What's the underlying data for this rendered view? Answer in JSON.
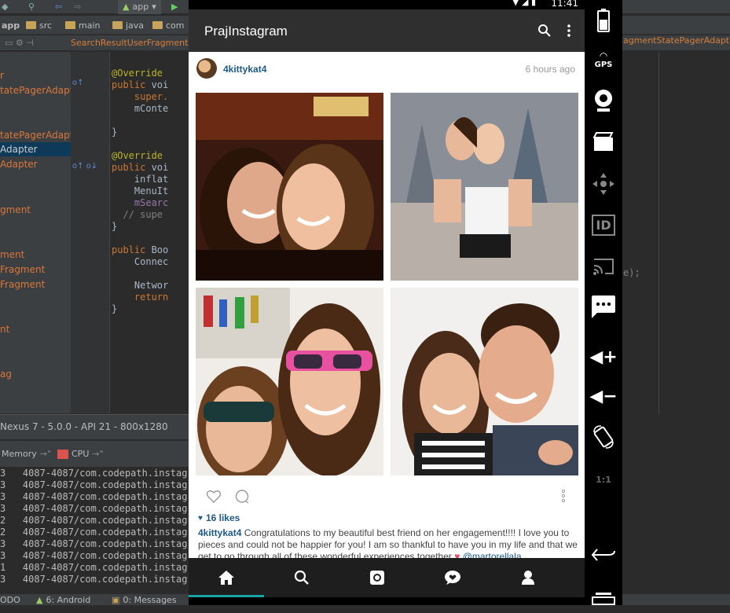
{
  "ide": {
    "toolbar": {
      "run_config": "app"
    },
    "breadcrumb": [
      "app",
      "src",
      "main",
      "java",
      "com"
    ],
    "open_tab": "SearchResultUserFragment.j",
    "right_tab": "agmentStatePagerAdapter",
    "project_items": [
      {
        "label": "r",
        "selected": false
      },
      {
        "label": "tatePagerAdapter",
        "selected": false
      },
      {
        "label": "tatePagerAdapter",
        "selected": false
      },
      {
        "label": "Adapter",
        "selected": true
      },
      {
        "label": "Adapter",
        "selected": false
      },
      {
        "label": "gment",
        "selected": false
      },
      {
        "label": "ment",
        "selected": false
      },
      {
        "label": "Fragment",
        "selected": false
      },
      {
        "label": "Fragment",
        "selected": false
      },
      {
        "label": "nt",
        "selected": false
      },
      {
        "label": "ag",
        "selected": false
      }
    ],
    "code_lines": [
      {
        "kw": "",
        "an": "@Override",
        "pl": ""
      },
      {
        "kw": "public ",
        "an": "",
        "pl": "voi"
      },
      {
        "kw": "",
        "an": "",
        "pl": "    super."
      },
      {
        "kw": "",
        "an": "",
        "pl": "    mConte"
      },
      {
        "kw": "",
        "an": "",
        "pl": ""
      },
      {
        "kw": "",
        "an": "",
        "pl": "}"
      },
      {
        "kw": "",
        "an": "",
        "pl": ""
      },
      {
        "kw": "",
        "an": "@Override",
        "pl": ""
      },
      {
        "kw": "public ",
        "an": "",
        "pl": "voi"
      },
      {
        "kw": "",
        "an": "",
        "pl": "    inflat"
      },
      {
        "kw": "",
        "an": "",
        "pl": "    MenuIt"
      },
      {
        "kw": "",
        "an": "",
        "pl": "    mSearc"
      },
      {
        "kw": "",
        "an": "",
        "pl": "  // supe"
      },
      {
        "kw": "",
        "an": "",
        "pl": "}"
      },
      {
        "kw": "",
        "an": "",
        "pl": ""
      },
      {
        "kw": "public ",
        "an": "",
        "pl": "Boo"
      },
      {
        "kw": "",
        "an": "",
        "pl": "    Connec"
      },
      {
        "kw": "",
        "an": "",
        "pl": ""
      },
      {
        "kw": "",
        "an": "",
        "pl": "    Networ"
      },
      {
        "kw": "",
        "an": "",
        "pl": "    return"
      },
      {
        "kw": "",
        "an": "",
        "pl": "}"
      },
      {
        "kw": "",
        "an": "",
        "pl": "}"
      }
    ],
    "right_code": "e);",
    "device_bar": "Nexus 7 - 5.0.0 - API 21 - 800x1280",
    "monitors": {
      "memory": "Memory",
      "cpu": "CPU"
    },
    "log_lines": [
      "3   4087-4087/com.codepath.instag",
      "3   4087-4087/com.codepath.instag",
      "3   4087-4087/com.codepath.instag",
      "3   4087-4087/com.codepath.instag",
      "2   4087-4087/com.codepath.instag",
      "2   4087-4087/com.codepath.instag",
      "3   4087-4087/com.codepath.instag",
      "3   4087-4087/com.codepath.instag",
      "1   4087-4087/com.codepath.instag",
      "3   4087-4087/com.codepath.instag"
    ],
    "status_items": [
      "ODO",
      "6: Android",
      "0: Messages"
    ]
  },
  "phone": {
    "time": "11:41",
    "app_title": "PrajInstagram",
    "post": {
      "username": "4kittykat4",
      "time_ago": "6 hours ago",
      "likes": "16 likes",
      "caption_user": "4kittykat4",
      "caption_text": " Congratulations to my beautiful best friend on her engagement!!!! I love you to pieces and could not be happier for you! I am so thankful to have you in my life and that we get to go through all of these wonderful experiences together ",
      "caption_mention": "@martorellala"
    },
    "nav": [
      "home-icon",
      "search-icon",
      "camera-icon",
      "activity-icon",
      "profile-icon"
    ]
  },
  "emulator_sidebar": [
    {
      "name": "battery-icon",
      "label": ""
    },
    {
      "name": "gps-button",
      "label": "GPS"
    },
    {
      "name": "webcam-icon",
      "label": ""
    },
    {
      "name": "media-icon",
      "label": ""
    },
    {
      "name": "dpad-icon",
      "label": ""
    },
    {
      "name": "id-button",
      "label": "ID"
    },
    {
      "name": "cast-icon",
      "label": ""
    },
    {
      "name": "sms-icon",
      "label": "•••"
    },
    {
      "name": "volume-up-button",
      "label": "+"
    },
    {
      "name": "volume-down-button",
      "label": "−"
    },
    {
      "name": "rotate-icon",
      "label": ""
    },
    {
      "name": "scale-button",
      "label": "1:1"
    },
    {
      "name": "back-button",
      "label": ""
    },
    {
      "name": "recents-button",
      "label": ""
    }
  ],
  "colors": {
    "ide_bg": "#2b2b2b",
    "appbar": "#2f2f2f",
    "link_blue": "#1b5a8a",
    "nav_accent": "#1aa3a3"
  }
}
